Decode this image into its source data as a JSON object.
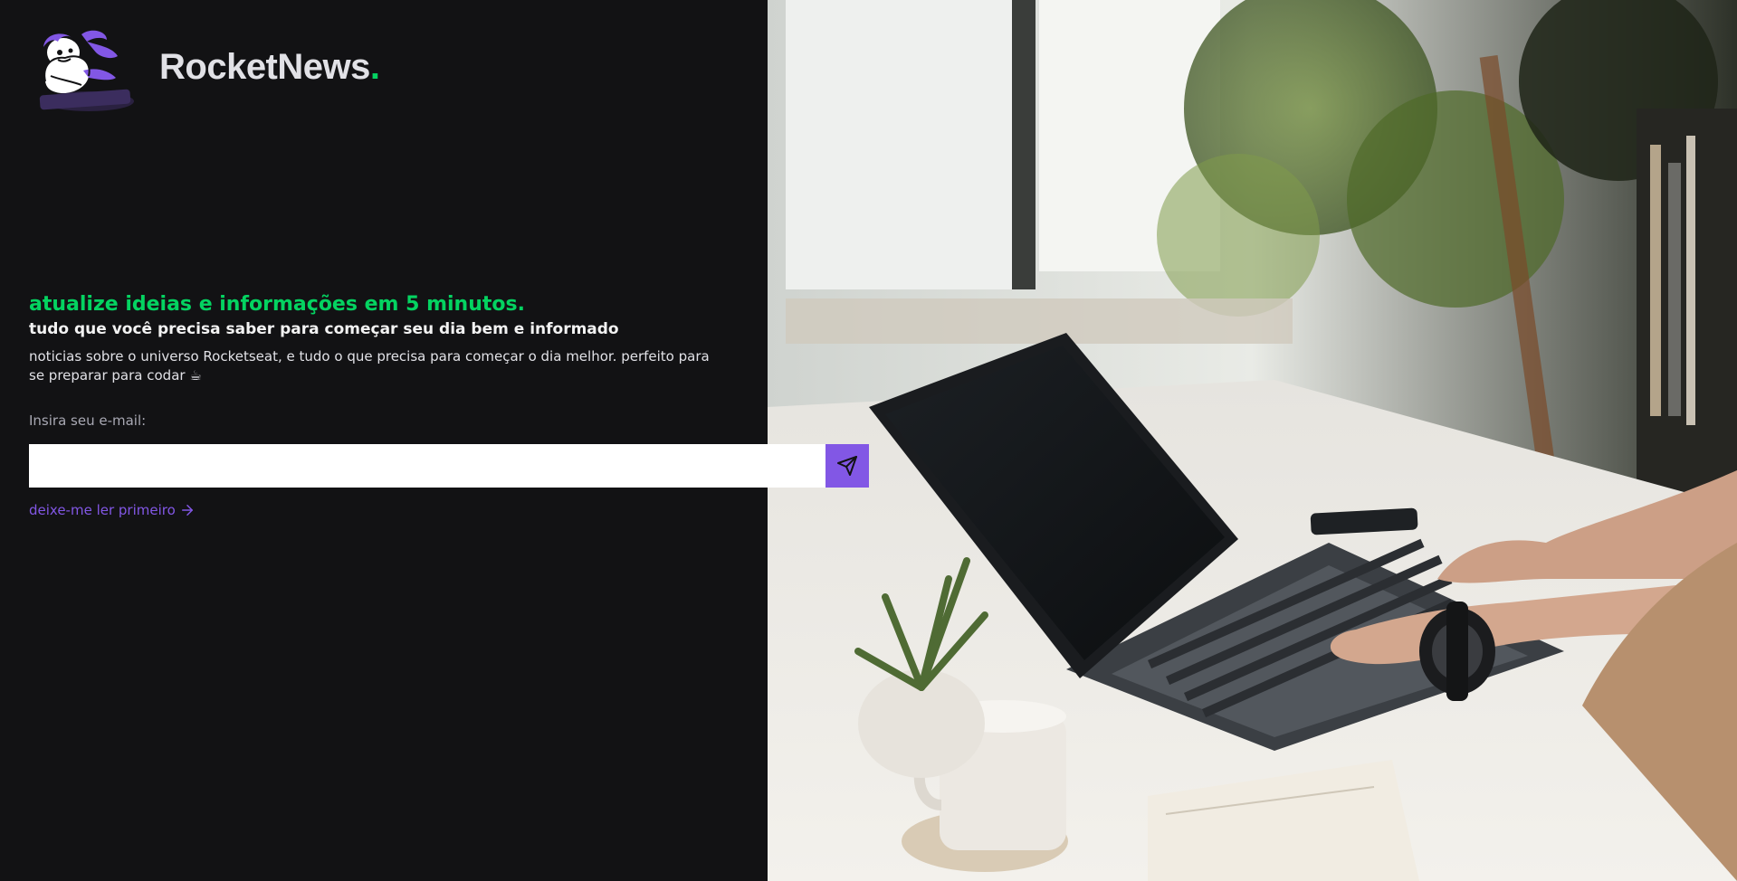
{
  "brand": {
    "name": "RocketNews",
    "dot": "."
  },
  "hero": {
    "headline": "atualize ideias e informações em 5 minutos.",
    "subheadline": "tudo que você precisa saber para começar seu dia bem e informado",
    "description": "noticias sobre o universo Rocketseat, e tudo o que precisa para começar o dia melhor. perfeito para se preparar para codar ☕"
  },
  "form": {
    "email_label": "Insira seu e-mail:",
    "email_value": "",
    "send_icon": "send-icon"
  },
  "links": {
    "read_first": "deixe-me ler primeiro",
    "read_first_icon": "arrow-right-icon"
  },
  "colors": {
    "background": "#121214",
    "accent_green": "#04d361",
    "accent_purple": "#8257e5",
    "text_light": "#e1e1e6",
    "text_muted": "#a8a8b3"
  }
}
